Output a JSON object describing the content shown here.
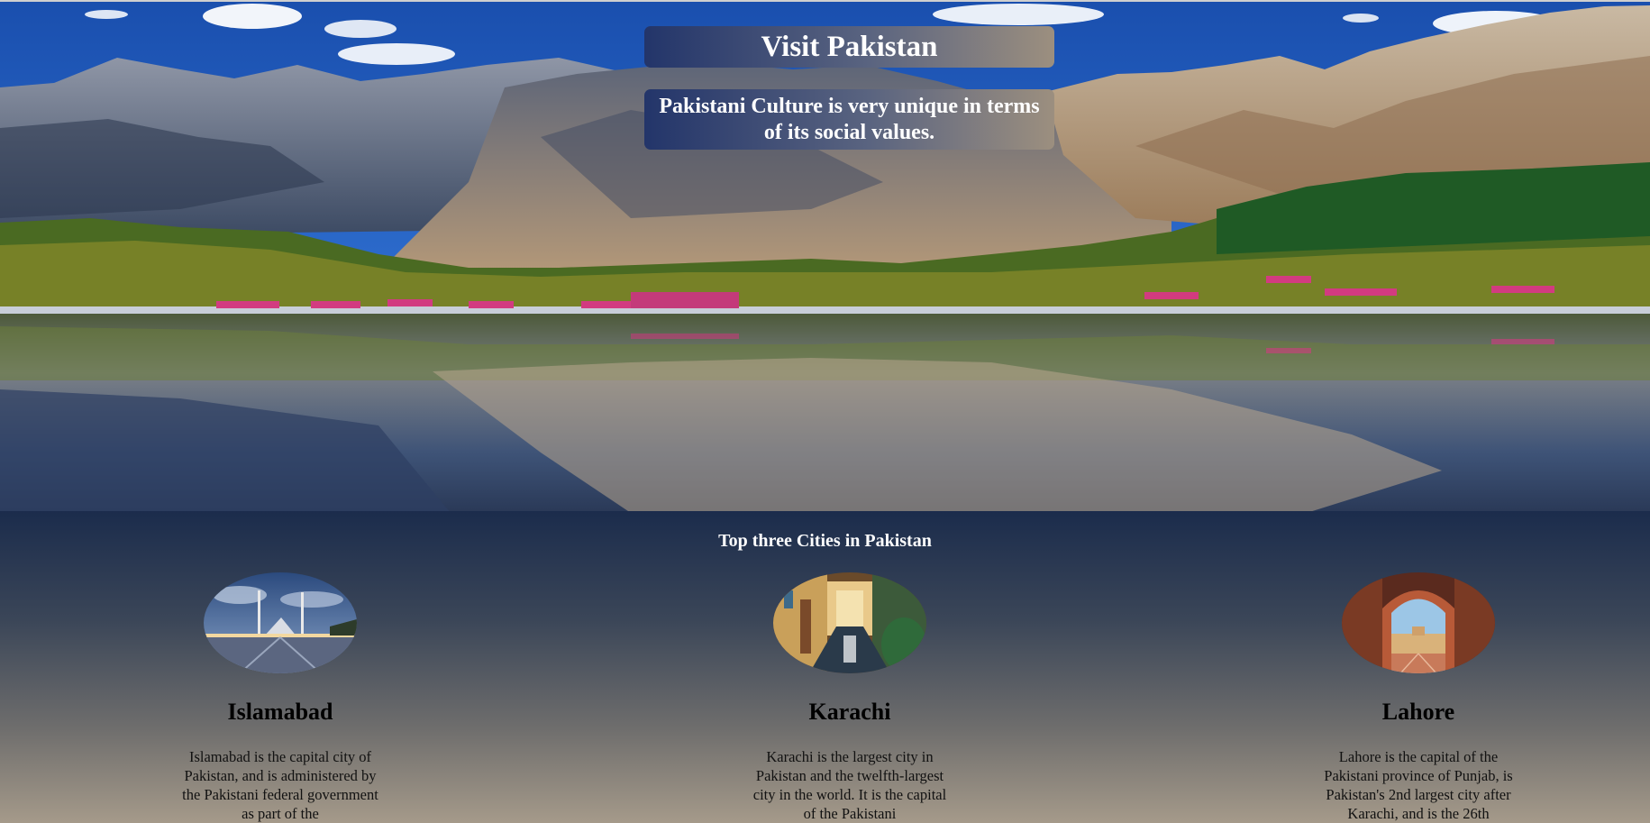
{
  "hero": {
    "title": "Visit Pakistan",
    "subtitle": "Pakistani Culture is very unique in terms of its social values."
  },
  "cities_section": {
    "heading": "Top three Cities in Pakistan",
    "cities": [
      {
        "name": "Islamabad",
        "description": "Islamabad is the capital city of Pakistan, and is administered by the Pakistani federal government as part of the"
      },
      {
        "name": "Karachi",
        "description": "Karachi is the largest city in Pakistan and the twelfth-largest city in the world. It is the capital of the Pakistani"
      },
      {
        "name": "Lahore",
        "description": "Lahore is the capital of the Pakistani province of Punjab, is Pakistan's 2nd largest city after Karachi, and is the 26th"
      }
    ]
  },
  "colors": {
    "banner_gradient_start": "#23356a",
    "banner_gradient_end": "#9c8f7f",
    "section_top": "#1b2c4c",
    "section_bottom": "#a59a8a"
  }
}
